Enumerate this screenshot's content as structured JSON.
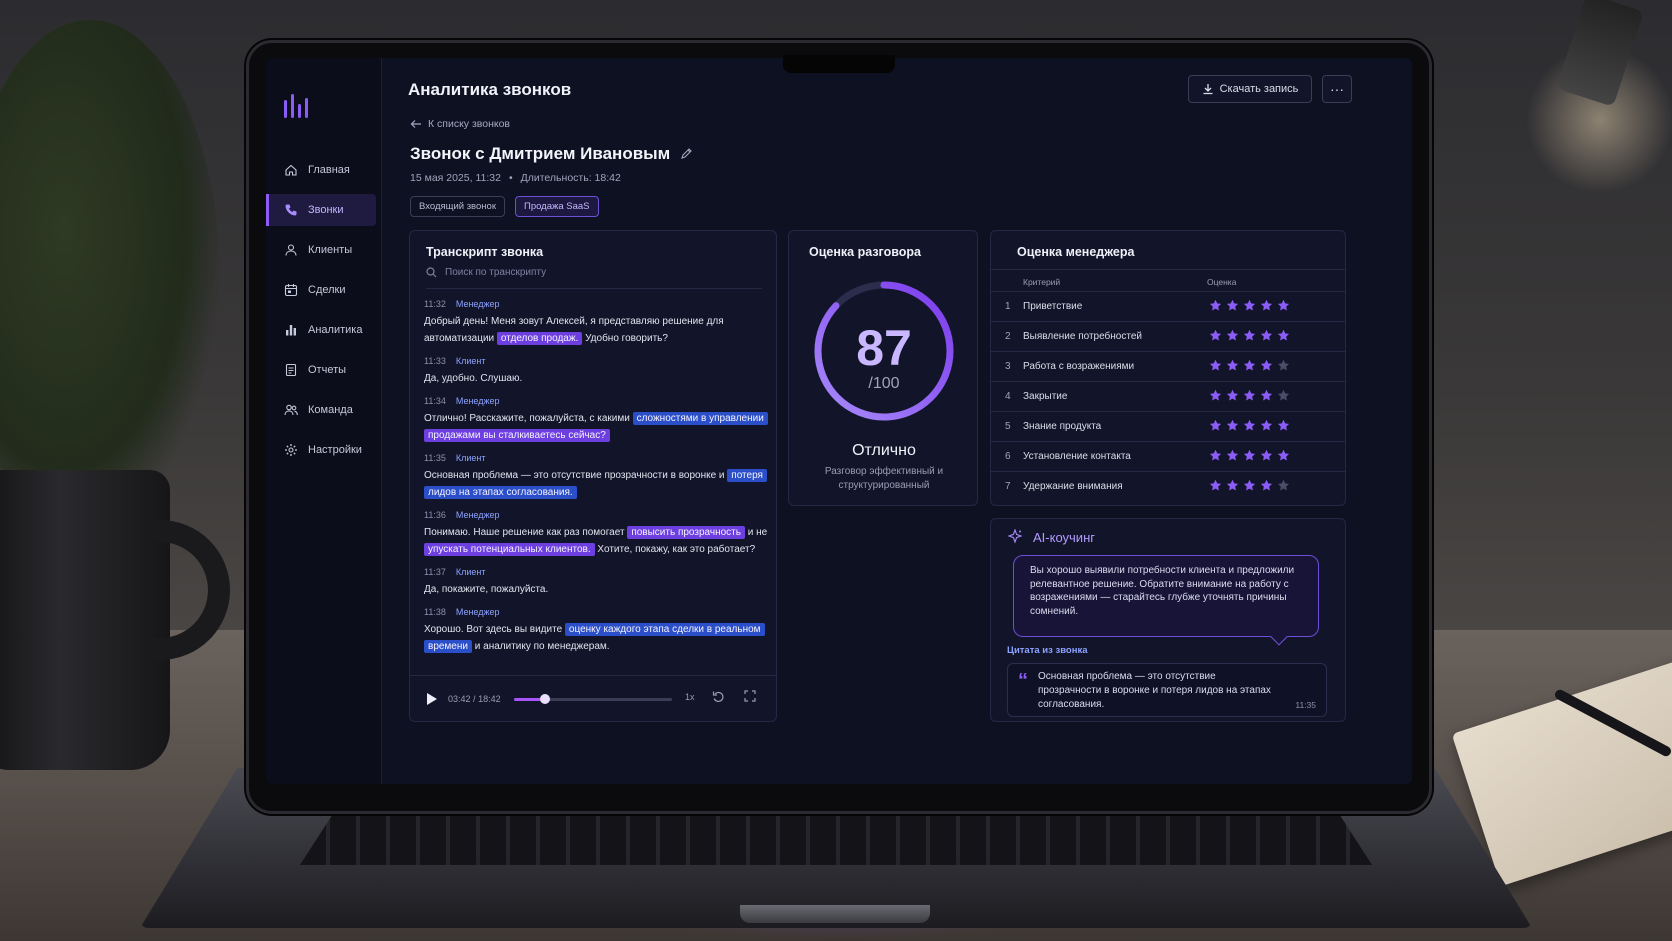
{
  "header": {
    "title": "Аналитика звонков",
    "download_label": "Скачать запись",
    "more_label": "···"
  },
  "sidebar": {
    "items": [
      {
        "label": "Главная",
        "icon": "home-icon"
      },
      {
        "label": "Звонки",
        "icon": "phone-icon",
        "active": true
      },
      {
        "label": "Клиенты",
        "icon": "user-icon"
      },
      {
        "label": "Сделки",
        "icon": "calendar-icon"
      },
      {
        "label": "Аналитика",
        "icon": "bar-chart-icon"
      },
      {
        "label": "Отчеты",
        "icon": "document-icon"
      },
      {
        "label": "Команда",
        "icon": "team-icon"
      },
      {
        "label": "Настройки",
        "icon": "gear-icon"
      }
    ]
  },
  "call": {
    "back_label": "К списку звонков",
    "title": "Звонок с Дмитрием Ивановым",
    "date": "15 мая 2025, 11:32",
    "separator": "•",
    "duration": "Длительность: 18:42",
    "tags": [
      "Входящий звонок",
      "Продажа SaaS"
    ]
  },
  "transcript": {
    "title": "Транскрипт звонка",
    "search_placeholder": "Поиск по транскрипту",
    "messages": [
      {
        "time": "11:32",
        "role": "Менеджер",
        "parts": [
          {
            "t": "Добрый день! Меня зовут Алексей, я представляю решение для автоматизации "
          },
          {
            "t": "отделов продаж.",
            "hl": "v"
          },
          {
            "t": " Удобно говорить?"
          }
        ]
      },
      {
        "time": "11:33",
        "role": "Клиент",
        "parts": [
          {
            "t": "Да, удобно. Слушаю."
          }
        ]
      },
      {
        "time": "11:34",
        "role": "Менеджер",
        "parts": [
          {
            "t": "Отлично! Расскажите, пожалуйста, с какими "
          },
          {
            "t": "сложностями в управлении",
            "hl": "b"
          },
          {
            "t": " "
          },
          {
            "t": "продажами вы сталкиваетесь сейчас?",
            "hl": "v"
          }
        ]
      },
      {
        "time": "11:35",
        "role": "Клиент",
        "parts": [
          {
            "t": "Основная проблема — это отсутствие прозрачности в воронке и "
          },
          {
            "t": "потеря",
            "hl": "b"
          },
          {
            "t": " "
          },
          {
            "t": "лидов на этапах согласования.",
            "hl": "b"
          }
        ]
      },
      {
        "time": "11:36",
        "role": "Менеджер",
        "parts": [
          {
            "t": "Понимаю. Наше решение как раз помогает "
          },
          {
            "t": "повысить прозрачность",
            "hl": "v"
          },
          {
            "t": " и не "
          },
          {
            "t": "упускать потенциальных клиентов.",
            "hl": "v"
          },
          {
            "t": " Хотите, покажу, как это работает?"
          }
        ]
      },
      {
        "time": "11:37",
        "role": "Клиент",
        "parts": [
          {
            "t": "Да, покажите, пожалуйста."
          }
        ]
      },
      {
        "time": "11:38",
        "role": "Менеджер",
        "parts": [
          {
            "t": "Хорошо. Вот здесь вы видите "
          },
          {
            "t": "оценку каждого этапа сделки в реальном",
            "hl": "b"
          },
          {
            "t": " "
          },
          {
            "t": "времени",
            "hl": "b"
          },
          {
            "t": " и аналитику по менеджерам."
          }
        ]
      }
    ]
  },
  "player": {
    "current": "03:42",
    "separator": "/",
    "total": "18:42",
    "progress": 0.198,
    "speed": "1x"
  },
  "score": {
    "title": "Оценка разговора",
    "value": 87,
    "max_label": "/100",
    "max": 100,
    "verdict": "Отлично",
    "description": "Разговор эффективный и структурированный"
  },
  "manager": {
    "title": "Оценка менеджера",
    "col_criterion": "Критерий",
    "col_rating": "Оценка",
    "rows": [
      {
        "n": "1",
        "label": "Приветствие",
        "stars": 5
      },
      {
        "n": "2",
        "label": "Выявление потребностей",
        "stars": 5
      },
      {
        "n": "3",
        "label": "Работа с возражениями",
        "stars": 4
      },
      {
        "n": "4",
        "label": "Закрытие",
        "stars": 4
      },
      {
        "n": "5",
        "label": "Знание продукта",
        "stars": 5
      },
      {
        "n": "6",
        "label": "Установление контакта",
        "stars": 5
      },
      {
        "n": "7",
        "label": "Удержание внимания",
        "stars": 4
      }
    ],
    "max_stars": 5
  },
  "coach": {
    "title": "AI-коучинг",
    "text": "Вы хорошо выявили потребности клиента и предложили релевантное решение. Обратите внимание на работу с возражениями — старайтесь глубже уточнять причины сомнений.",
    "quote_label": "Цитата из звонка",
    "quote": "Основная проблема — это отсутствие прозрачности в воронке и потеря лидов на этапах согласования.",
    "quote_time": "11:35"
  },
  "colors": {
    "accent": "#8b5cf6",
    "highlight_violet": "#6d3fe0",
    "highlight_blue": "#2b4fc8",
    "background": "#0e1122",
    "card": "#12152a",
    "star_empty": "#4a4d66"
  }
}
